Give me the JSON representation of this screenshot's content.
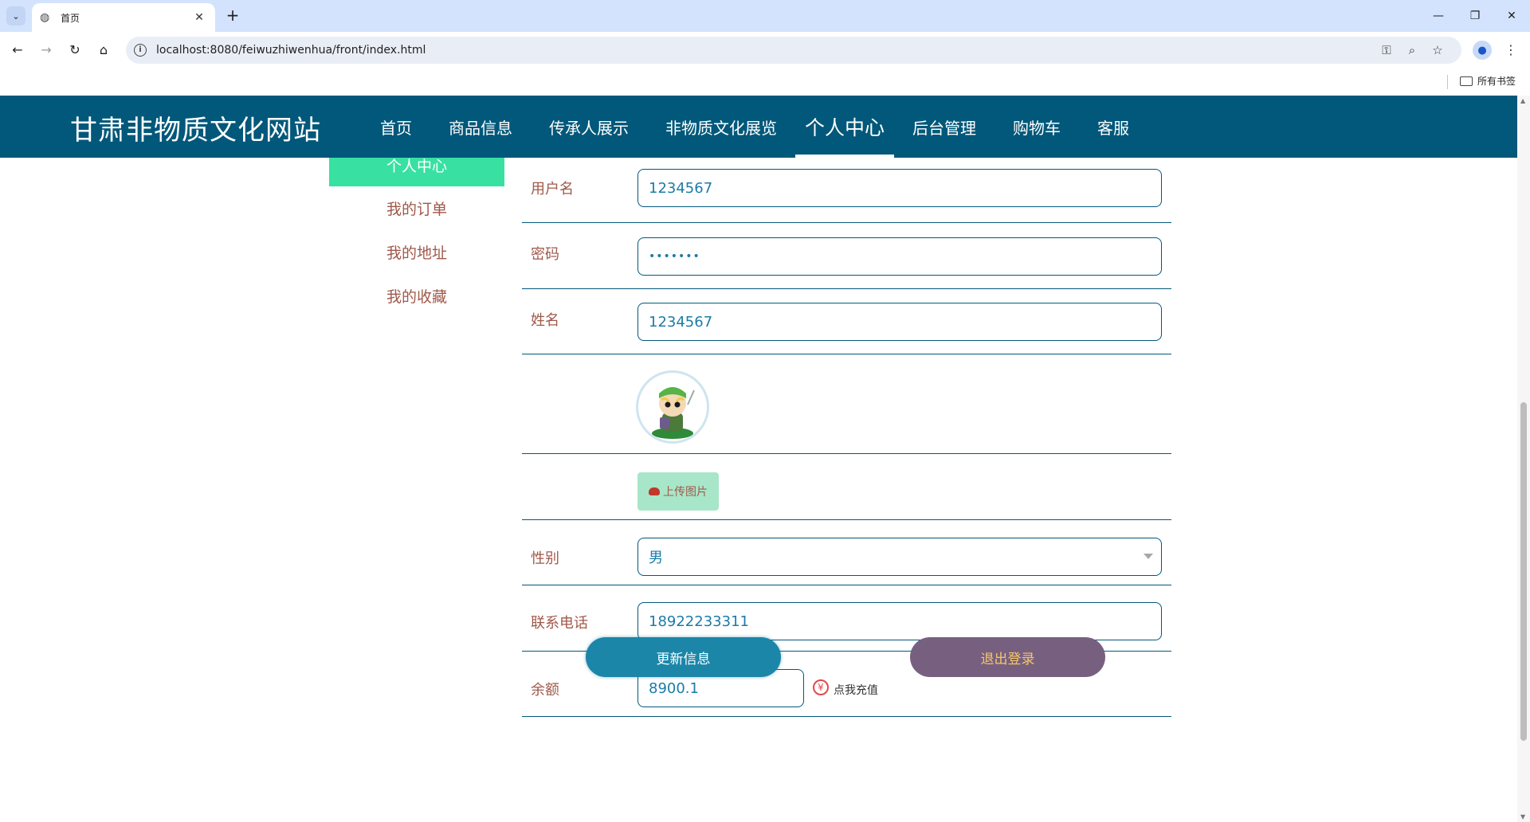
{
  "browser": {
    "tab_title": "首页",
    "url": "localhost:8080/feiwuzhiwenhua/front/index.html",
    "bookmarks_label": "所有书签"
  },
  "site": {
    "title": "甘肃非物质文化网站",
    "nav": [
      "首页",
      "商品信息",
      "传承人展示",
      "非物质文化展览",
      "个人中心",
      "后台管理",
      "购物车",
      "客服"
    ],
    "active_nav": "个人中心"
  },
  "side_menu": {
    "items": [
      "个人中心",
      "我的订单",
      "我的地址",
      "我的收藏"
    ]
  },
  "form": {
    "username_label": "用户名",
    "username_value": "1234567",
    "password_label": "密码",
    "password_value": "•••••••",
    "name_label": "姓名",
    "name_value": "1234567",
    "upload_label": "上传图片",
    "gender_label": "性别",
    "gender_value": "男",
    "phone_label": "联系电话",
    "phone_value": "18922233311",
    "balance_label": "余额",
    "balance_value": "8900.1",
    "recharge_symbol": "¥",
    "recharge_label": "点我充值"
  },
  "buttons": {
    "update": "更新信息",
    "logout": "退出登录"
  },
  "colors": {
    "header_bg": "#02587a",
    "side_active": "#38e1a1",
    "label_text": "#a0594a",
    "update_button": "#1c86a8",
    "logout_button": "#77607f"
  }
}
